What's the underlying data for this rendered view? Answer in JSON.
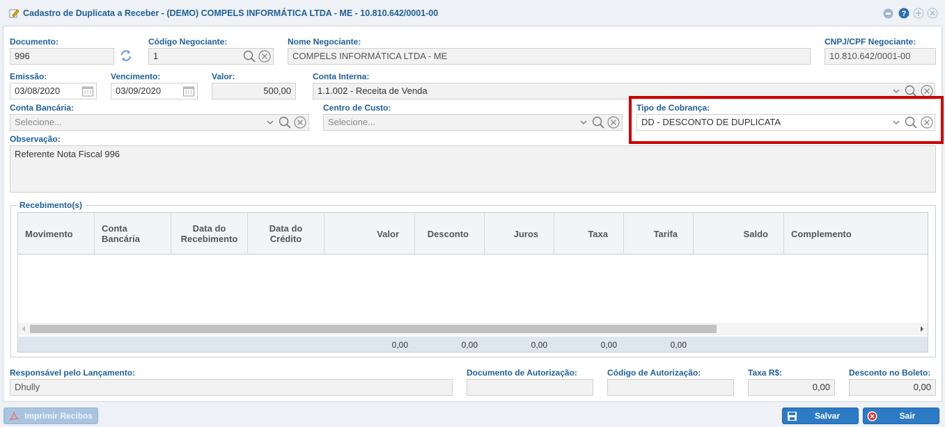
{
  "window": {
    "title": "Cadastro de Duplicata a Receber - (DEMO) COMPELS INFORMÁTICA LTDA - ME - 10.810.642/0001-00"
  },
  "form": {
    "documento": {
      "label": "Documento:",
      "value": "996"
    },
    "codigo_negociante": {
      "label": "Código Negociante:",
      "value": "1"
    },
    "nome_negociante": {
      "label": "Nome Negociante:",
      "value": "COMPELS INFORMÁTICA LTDA - ME"
    },
    "cnpj": {
      "label": "CNPJ/CPF Negociante:",
      "value": "10.810.642/0001-00"
    },
    "emissao": {
      "label": "Emissão:",
      "value": "03/08/2020"
    },
    "vencimento": {
      "label": "Vencimento:",
      "value": "03/09/2020"
    },
    "valor": {
      "label": "Valor:",
      "value": "500,00"
    },
    "conta_interna": {
      "label": "Conta Interna:",
      "value": "1.1.002 - Receita de Venda"
    },
    "conta_bancaria": {
      "label": "Conta Bancária:",
      "placeholder": "Selecione..."
    },
    "centro_custo": {
      "label": "Centro de Custo:",
      "placeholder": "Selecione..."
    },
    "tipo_cobranca": {
      "label": "Tipo de Cobrança:",
      "value": "DD - DESCONTO DE DUPLICATA"
    },
    "observacao": {
      "label": "Observação:",
      "value": "Referente Nota Fiscal 996"
    }
  },
  "recebimentos": {
    "legend": "Recebimento(s)",
    "columns": {
      "movimento": "Movimento",
      "conta_bancaria_1": "Conta",
      "conta_bancaria_2": "Bancária",
      "data_receb_1": "Data do",
      "data_receb_2": "Recebimento",
      "data_cred_1": "Data do",
      "data_cred_2": "Crédito",
      "valor": "Valor",
      "desconto": "Desconto",
      "juros": "Juros",
      "taxa": "Taxa",
      "tarifa": "Tarifa",
      "saldo": "Saldo",
      "complemento": "Complemento"
    },
    "totals": {
      "valor": "0,00",
      "desconto": "0,00",
      "juros": "0,00",
      "taxa": "0,00",
      "tarifa": "0,00"
    }
  },
  "footer": {
    "responsavel": {
      "label": "Responsável pelo Lançamento:",
      "value": "Dhully"
    },
    "doc_autorizacao": {
      "label": "Documento de Autorização:",
      "value": ""
    },
    "cod_autorizacao": {
      "label": "Código de Autorização:",
      "value": ""
    },
    "taxa": {
      "label": "Taxa R$:",
      "value": "0,00"
    },
    "desconto_boleto": {
      "label": "Desconto no Boleto:",
      "value": "0,00"
    }
  },
  "buttons": {
    "imprimir": "Imprimir Recibos",
    "salvar": "Salvar",
    "sair": "Sair"
  },
  "icons": [
    "edit-icon",
    "minimize-icon",
    "help-icon",
    "maximize-icon",
    "close-icon",
    "refresh-icon",
    "search-icon",
    "clear-icon",
    "calendar-icon",
    "chevron-down-icon",
    "pdf-icon",
    "save-icon",
    "exit-icon"
  ],
  "colors": {
    "label": "#1e5f99",
    "highlight": "#cc0000",
    "button": "#2d7bc4"
  }
}
